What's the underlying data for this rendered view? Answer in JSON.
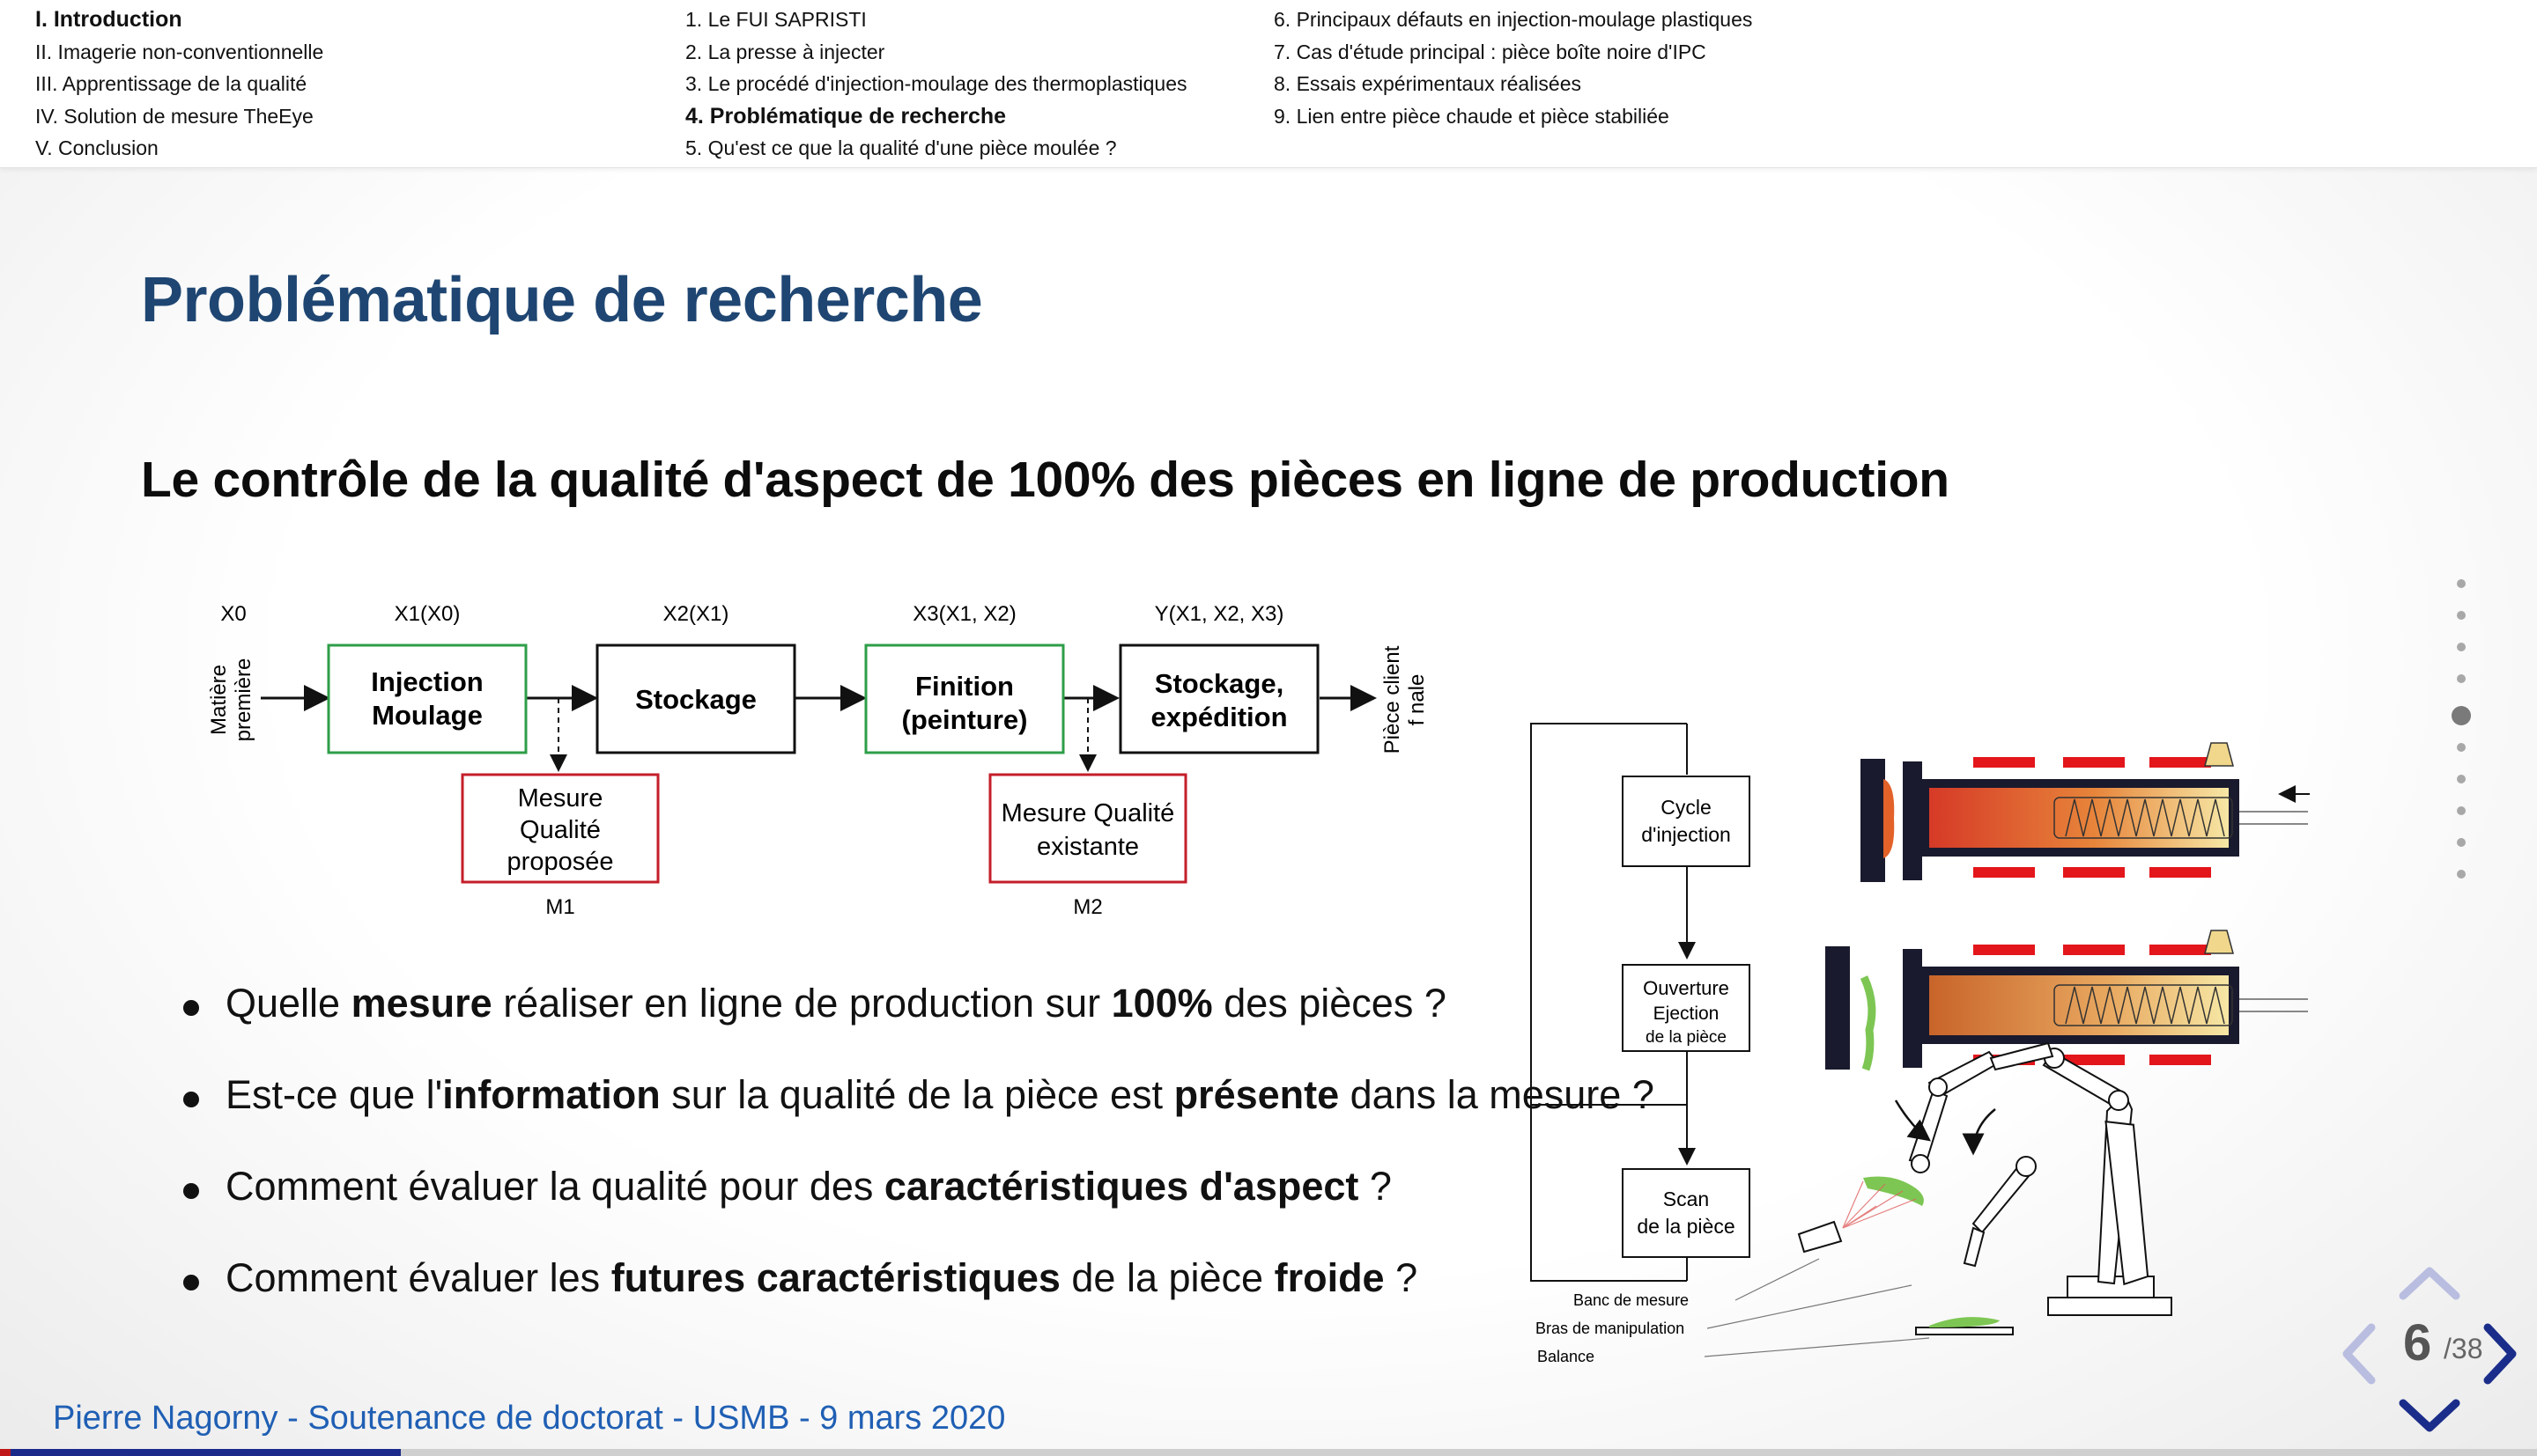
{
  "nav": {
    "sections": [
      {
        "label": "I. Introduction",
        "active": true
      },
      {
        "label": "II. Imagerie non-conventionnelle",
        "active": false
      },
      {
        "label": "III. Apprentissage de la qualité",
        "active": false
      },
      {
        "label": "IV. Solution de mesure TheEye",
        "active": false
      },
      {
        "label": "V. Conclusion",
        "active": false
      }
    ],
    "subsections_col1": [
      {
        "label": "1. Le FUI SAPRISTI",
        "active": false
      },
      {
        "label": "2. La presse à injecter",
        "active": false
      },
      {
        "label": "3. Le procédé d'injection-moulage des thermoplastiques",
        "active": false
      },
      {
        "label": "4. Problématique de recherche",
        "active": true
      },
      {
        "label": "5. Qu'est ce que la qualité d'une pièce moulée ?",
        "active": false
      }
    ],
    "subsections_col2": [
      {
        "label": "6. Principaux défauts en injection-moulage plastiques",
        "active": false
      },
      {
        "label": "7. Cas d'étude principal : pièce boîte noire d'IPC",
        "active": false
      },
      {
        "label": "8. Essais expérimentaux réalisées",
        "active": false
      },
      {
        "label": "9. Lien entre pièce chaude et pièce stabiliée",
        "active": false
      }
    ]
  },
  "slide": {
    "title": "Problématique de recherche",
    "subtitle": "Le contrôle de la qualité d'aspect de 100% des pièces en ligne de production",
    "bullets": [
      [
        {
          "t": "Quelle "
        },
        {
          "t": "mesure",
          "b": true
        },
        {
          "t": " réaliser en ligne de production sur "
        },
        {
          "t": "100%",
          "b": true
        },
        {
          "t": " des pièces ?"
        }
      ],
      [
        {
          "t": "Est-ce que l'"
        },
        {
          "t": "information",
          "b": true
        },
        {
          "t": " sur la qualité de la pièce est "
        },
        {
          "t": "présente",
          "b": true
        },
        {
          "t": " dans la mesure ?"
        }
      ],
      [
        {
          "t": "Comment évaluer la qualité pour des "
        },
        {
          "t": "caractéristiques d'aspect",
          "b": true
        },
        {
          "t": " ?"
        }
      ],
      [
        {
          "t": "Comment évaluer les "
        },
        {
          "t": "futures caractéristiques",
          "b": true
        },
        {
          "t": " de la pièce "
        },
        {
          "t": "froide",
          "b": true
        },
        {
          "t": " ?"
        }
      ]
    ]
  },
  "flow": {
    "input_label_line1": "Matière",
    "input_label_line2": "première",
    "output_label_line1": "Pièce client",
    "output_label_line2": "f nale",
    "var_labels": [
      "X0",
      "X1(X0)",
      "X2(X1)",
      "X3(X1, X2)",
      "Y(X1, X2, X3)"
    ],
    "steps": [
      {
        "line1": "Injection",
        "line2": "Moulage",
        "color": "#2e9e48",
        "bold": true
      },
      {
        "line1": "Stockage",
        "line2": "",
        "color": "#111111",
        "bold": true
      },
      {
        "line1": "Finition",
        "line2": "(peinture)",
        "color": "#2e9e48",
        "bold": true
      },
      {
        "line1": "Stockage,",
        "line2": "expédition",
        "color": "#111111",
        "bold": true
      }
    ],
    "measures": [
      {
        "line1": "Mesure",
        "line2": "Qualité",
        "line3": "proposée",
        "tag": "M1",
        "color": "#c41e2a"
      },
      {
        "line1": "Mesure Qualité",
        "line2": "existante",
        "line3": "",
        "tag": "M2",
        "color": "#c41e2a"
      }
    ]
  },
  "process": {
    "cycle_line1": "Cycle",
    "cycle_line2": "d'injection",
    "eject_line1": "Ouverture",
    "eject_line2": "Ejection",
    "eject_line3": "de la pièce",
    "scan_line1": "Scan",
    "scan_line2": "de la pièce",
    "legend": [
      "Banc de mesure",
      "Bras de manipulation",
      "Balance"
    ],
    "colors": {
      "heat": "#d8412a",
      "part": "#7dc653",
      "heater": "#e3161b",
      "barrel": "#1a1a2e"
    }
  },
  "pager": {
    "current": "6",
    "total": "/38",
    "progress_fraction": 0.158
  },
  "footer": {
    "text": "Pierre Nagorny - Soutenance de doctorat - USMB - 9 mars 2020"
  },
  "accent": "#1f4672"
}
